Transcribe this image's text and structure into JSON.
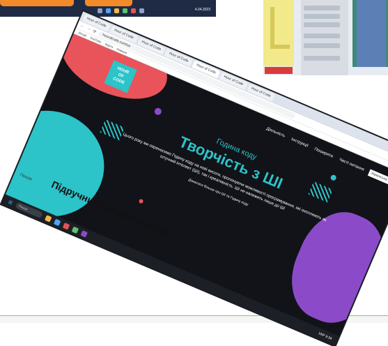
{
  "background": {
    "top_strip": {
      "clock": [
        "",
        "4.04.2023"
      ]
    },
    "colors": {
      "navy": "#1f2b45",
      "orange": "#f28a2a"
    }
  },
  "browser": {
    "tabs": [
      "Hour of Code",
      "Hour of Code",
      "Hour of Code",
      "Hour of Code",
      "Hour of Code",
      "Hour of Code",
      "Hour of Code"
    ],
    "url": "hourofcode.com/ua",
    "bookmarks": [
      "Gmail",
      "YouTube",
      "Карти",
      "Новини"
    ]
  },
  "page": {
    "logo": [
      "HOUR",
      "OF",
      "CODE"
    ],
    "nav": [
      "Діяльність",
      "Інструкції",
      "Поширити",
      "Часті питання"
    ],
    "language": "Українська",
    "hero": {
      "subtitle": "Година коду",
      "title": "Творчість з ШІ",
      "description": "Цього року ми переносимо Годину коду на нові висоти, пропонуючи можливості програмування, які охоплюють як штучний інтелект (ШІ), так і креативність. ШІ не належить лише до ШІ",
      "note": "Дізнатися більше про ШІ та Годину коду"
    },
    "section_heading": "Підручники вашою мовою",
    "side_search": "Пошук"
  },
  "taskbar": {
    "search": "Пошук",
    "tray": [
      "УКР",
      "9:34"
    ]
  }
}
